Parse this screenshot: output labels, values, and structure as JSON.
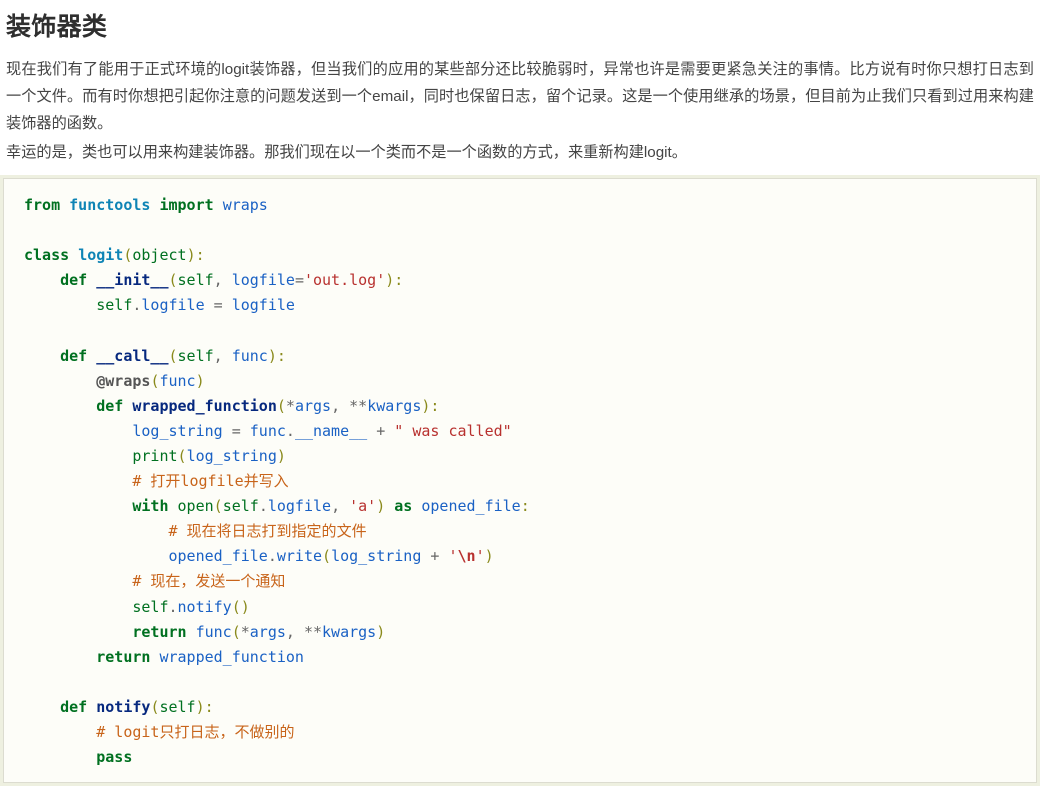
{
  "article": {
    "title": "装饰器类",
    "paragraphs": [
      "现在我们有了能用于正式环境的logit装饰器，但当我们的应用的某些部分还比较脆弱时，异常也许是需要更紧急关注的事情。比方说有时你只想打日志到一个文件。而有时你想把引起你注意的问题发送到一个email，同时也保留日志，留个记录。这是一个使用继承的场景，但目前为止我们只看到过用来构建装饰器的函数。",
      "幸运的是，类也可以用来构建装饰器。那我们现在以一个类而不是一个函数的方式，来重新构建logit。"
    ]
  },
  "code_block": {
    "language": "python",
    "full_text": "from functools import wraps\n\nclass logit(object):\n    def __init__(self, logfile='out.log'):\n        self.logfile = logfile\n\n    def __call__(self, func):\n        @wraps(func)\n        def wrapped_function(*args, **kwargs):\n            log_string = func.__name__ + \" was called\"\n            print(log_string)\n            # 打开logfile并写入\n            with open(self.logfile, 'a') as opened_file:\n                # 现在将日志打到指定的文件\n                opened_file.write(log_string + '\\n')\n            # 现在，发送一个通知\n            self.notify()\n            return func(*args, **kwargs)\n        return wrapped_function\n\n    def notify(self):\n        # logit只打日志，不做别的\n        pass",
    "lines": [
      "from functools import wraps",
      "",
      "class logit(object):",
      "    def __init__(self, logfile='out.log'):",
      "        self.logfile = logfile",
      "",
      "    def __call__(self, func):",
      "        @wraps(func)",
      "        def wrapped_function(*args, **kwargs):",
      "            log_string = func.__name__ + \" was called\"",
      "            print(log_string)",
      "            # 打开logfile并写入",
      "            with open(self.logfile, 'a') as opened_file:",
      "                # 现在将日志打到指定的文件",
      "                opened_file.write(log_string + '\\n')",
      "            # 现在，发送一个通知",
      "            self.notify()",
      "            return func(*args, **kwargs)",
      "        return wrapped_function",
      "",
      "    def notify(self):",
      "        # logit只打日志，不做别的",
      "        pass"
    ],
    "comments": [
      "# 打开logfile并写入",
      "# 现在将日志打到指定的文件",
      "# 现在，发送一个通知",
      "# logit只打日志，不做别的"
    ],
    "strings": [
      "'out.log'",
      "\" was called\"",
      "'a'",
      "'\\n'"
    ]
  },
  "colors": {
    "page_background": "#ffffff",
    "text": "#444444",
    "heading": "#2f2f2f",
    "code_background": "#fdfdf8",
    "code_border": "#dcdcd0",
    "code_outer_background": "#eef0e0",
    "keyword": "#007020",
    "name": "#1a61c4",
    "function": "#06287e",
    "string": "#b8312f",
    "comment": "#c8641a",
    "punctuation": "#8a8a1c",
    "operator": "#666666",
    "decorator": "#555555"
  }
}
